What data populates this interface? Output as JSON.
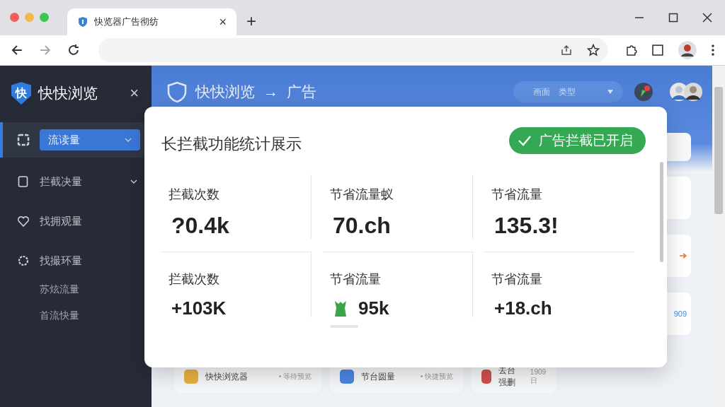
{
  "tab": {
    "title": "快览器广告彻纺",
    "close": "×"
  },
  "new_tab": "+",
  "sidebar": {
    "logo_char": "快",
    "brand": "快快浏览",
    "close": "×",
    "items": [
      {
        "label": "流读量",
        "selected": true,
        "dropdown": true
      },
      {
        "label": "拦截决量",
        "selected": false,
        "dropdown": true
      },
      {
        "label": "找拥观量",
        "selected": false,
        "dropdown": false
      },
      {
        "label": "找撮环量",
        "selected": false,
        "dropdown": false,
        "children": [
          {
            "label": "苏炫流量",
            "selected": false
          },
          {
            "label": "首流快量",
            "selected": false
          }
        ]
      }
    ]
  },
  "header": {
    "title": "快快浏览",
    "arrow": "→",
    "section": "广告",
    "filter": "画面　类型"
  },
  "dialog": {
    "title": "长拦截功能统计展示",
    "status": "广告拦截已开启",
    "stats": [
      {
        "label": "拦截次数",
        "value": "?0.4k",
        "kind": "plain"
      },
      {
        "label": "节省流量蚁",
        "value": "70.ch",
        "kind": "plain"
      },
      {
        "label": "节省流量",
        "value": "135.3!",
        "kind": "plain"
      },
      {
        "label": "拦截次数",
        "value": "+103K",
        "kind": "plain"
      },
      {
        "label": "节省流量",
        "value": "95k",
        "kind": "icon"
      },
      {
        "label": "节省流量",
        "value": "+18.ch",
        "kind": "plain"
      }
    ]
  },
  "side_card": {
    "text": "909"
  },
  "bottom_cards": [
    {
      "title": "快快浏览器",
      "note": "• 等待预览",
      "color": "#e8b040"
    },
    {
      "title": "节台圆量",
      "note": "• 快捷预览",
      "color": "#4a86e0"
    },
    {
      "title": "去台强删",
      "note": "1909日",
      "color": "#d05050"
    }
  ]
}
